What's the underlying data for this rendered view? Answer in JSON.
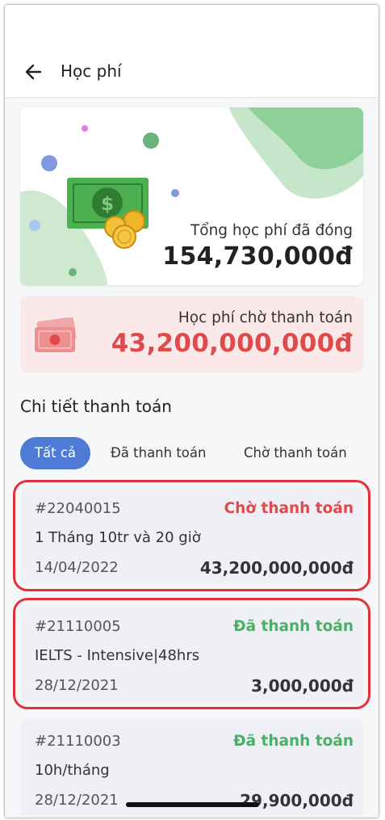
{
  "header": {
    "title": "Học phí"
  },
  "summary": {
    "total_label": "Tổng học phí đã đóng",
    "total_amount": "154,730,000đ",
    "pending_label": "Học phí chờ thanh toán",
    "pending_amount": "43,200,000,000đ"
  },
  "section_title": "Chi tiết thanh toán",
  "tabs": [
    {
      "label": "Tất cả",
      "active": true
    },
    {
      "label": "Đã thanh toán",
      "active": false
    },
    {
      "label": "Chờ thanh toán",
      "active": false
    }
  ],
  "payments": [
    {
      "code": "#22040015",
      "status": "Chờ thanh toán",
      "status_type": "pending",
      "name": "1 Tháng 10tr và 20 giờ",
      "date": "14/04/2022",
      "amount": "43,200,000,000đ"
    },
    {
      "code": "#21110005",
      "status": "Đã thanh toán",
      "status_type": "paid",
      "name": "IELTS - Intensive|48hrs",
      "date": "28/12/2021",
      "amount": "3,000,000đ"
    },
    {
      "code": "#21110003",
      "status": "Đã thanh toán",
      "status_type": "paid",
      "name": "10h/tháng",
      "date": "28/12/2021",
      "amount": "29,900,000đ"
    }
  ],
  "colors": {
    "accent": "#4d7bd6",
    "pending": "#e04a4a",
    "paid": "#4caf66",
    "highlight_outline": "#e2303d"
  },
  "icons": {
    "back": "arrow-left-icon",
    "money_illustration": "cash-coins-illustration",
    "pending": "banknote-icon"
  }
}
